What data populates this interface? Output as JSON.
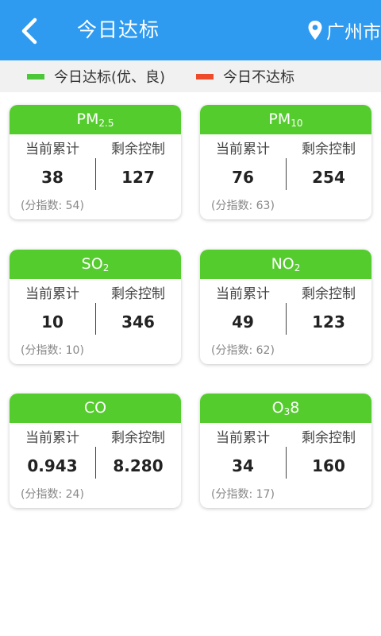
{
  "header": {
    "title": "今日达标",
    "city": "广州市"
  },
  "legend": {
    "good_label": "今日达标(优、良)",
    "bad_label": "今日不达标",
    "good_color": "#4cc73a",
    "bad_color": "#ee4b2b"
  },
  "colors": {
    "header_bg": "#2e9bf0",
    "card_head": "#55cc2e"
  },
  "cards": [
    {
      "name": "PM",
      "sub": "2.5",
      "suffix": "",
      "left_label": "当前累计",
      "left_value": "38",
      "right_label": "剩余控制",
      "right_value": "127",
      "sub_index": "(分指数: 54)"
    },
    {
      "name": "PM",
      "sub": "10",
      "suffix": "",
      "left_label": "当前累计",
      "left_value": "76",
      "right_label": "剩余控制",
      "right_value": "254",
      "sub_index": "(分指数: 63)"
    },
    {
      "name": "SO",
      "sub": "2",
      "suffix": "",
      "left_label": "当前累计",
      "left_value": "10",
      "right_label": "剩余控制",
      "right_value": "346",
      "sub_index": "(分指数: 10)"
    },
    {
      "name": "NO",
      "sub": "2",
      "suffix": "",
      "left_label": "当前累计",
      "left_value": "49",
      "right_label": "剩余控制",
      "right_value": "123",
      "sub_index": "(分指数: 62)"
    },
    {
      "name": "CO",
      "sub": "",
      "suffix": "",
      "left_label": "当前累计",
      "left_value": "0.943",
      "right_label": "剩余控制",
      "right_value": "8.280",
      "sub_index": "(分指数: 24)"
    },
    {
      "name": "O",
      "sub": "3",
      "suffix": "8",
      "left_label": "当前累计",
      "left_value": "34",
      "right_label": "剩余控制",
      "right_value": "160",
      "sub_index": "(分指数: 17)"
    }
  ]
}
